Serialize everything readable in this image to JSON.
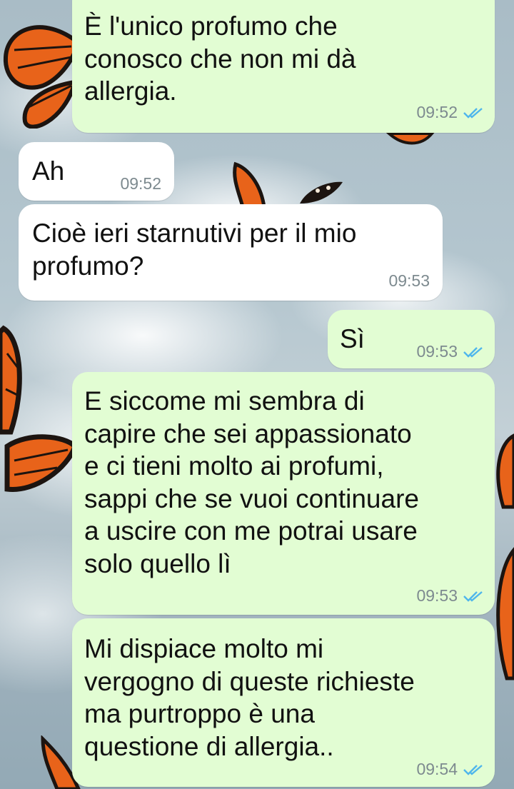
{
  "messages": [
    {
      "direction": "outgoing",
      "text": "È l'unico profumo che\nconosco che non mi dà\nallergia.",
      "time": "09:52",
      "status_icon": "double-check-read-icon"
    },
    {
      "direction": "incoming",
      "text": "Ah",
      "time": "09:52"
    },
    {
      "direction": "incoming",
      "text": "Cioè ieri starnutivi per il mio\nprofumo?",
      "time": "09:53"
    },
    {
      "direction": "outgoing",
      "text": "Sì",
      "time": "09:53",
      "status_icon": "double-check-read-icon"
    },
    {
      "direction": "outgoing",
      "text": "E siccome mi sembra di\ncapire che sei appassionato\ne ci tieni molto ai profumi,\nsappi che se vuoi continuare\na uscire con me potrai usare\nsolo quello lì",
      "time": "09:53",
      "status_icon": "double-check-read-icon"
    },
    {
      "direction": "outgoing",
      "text": "Mi dispiace molto mi\nvergogno di queste richieste\nma purtroppo è una\nquestione di allergia..",
      "time": "09:54",
      "status_icon": "double-check-read-icon"
    }
  ],
  "colors": {
    "outgoing_bubble": "#e2fdd3",
    "incoming_bubble": "#ffffff",
    "read_ticks": "#4fb6ec",
    "timestamp": "#7d8a8f",
    "butterfly_wing": "#e8631a",
    "butterfly_vein": "#1c1410"
  },
  "wallpaper": {
    "theme": "sky with clouds and monarch butterflies",
    "icon": "monarch-butterfly-icon"
  }
}
